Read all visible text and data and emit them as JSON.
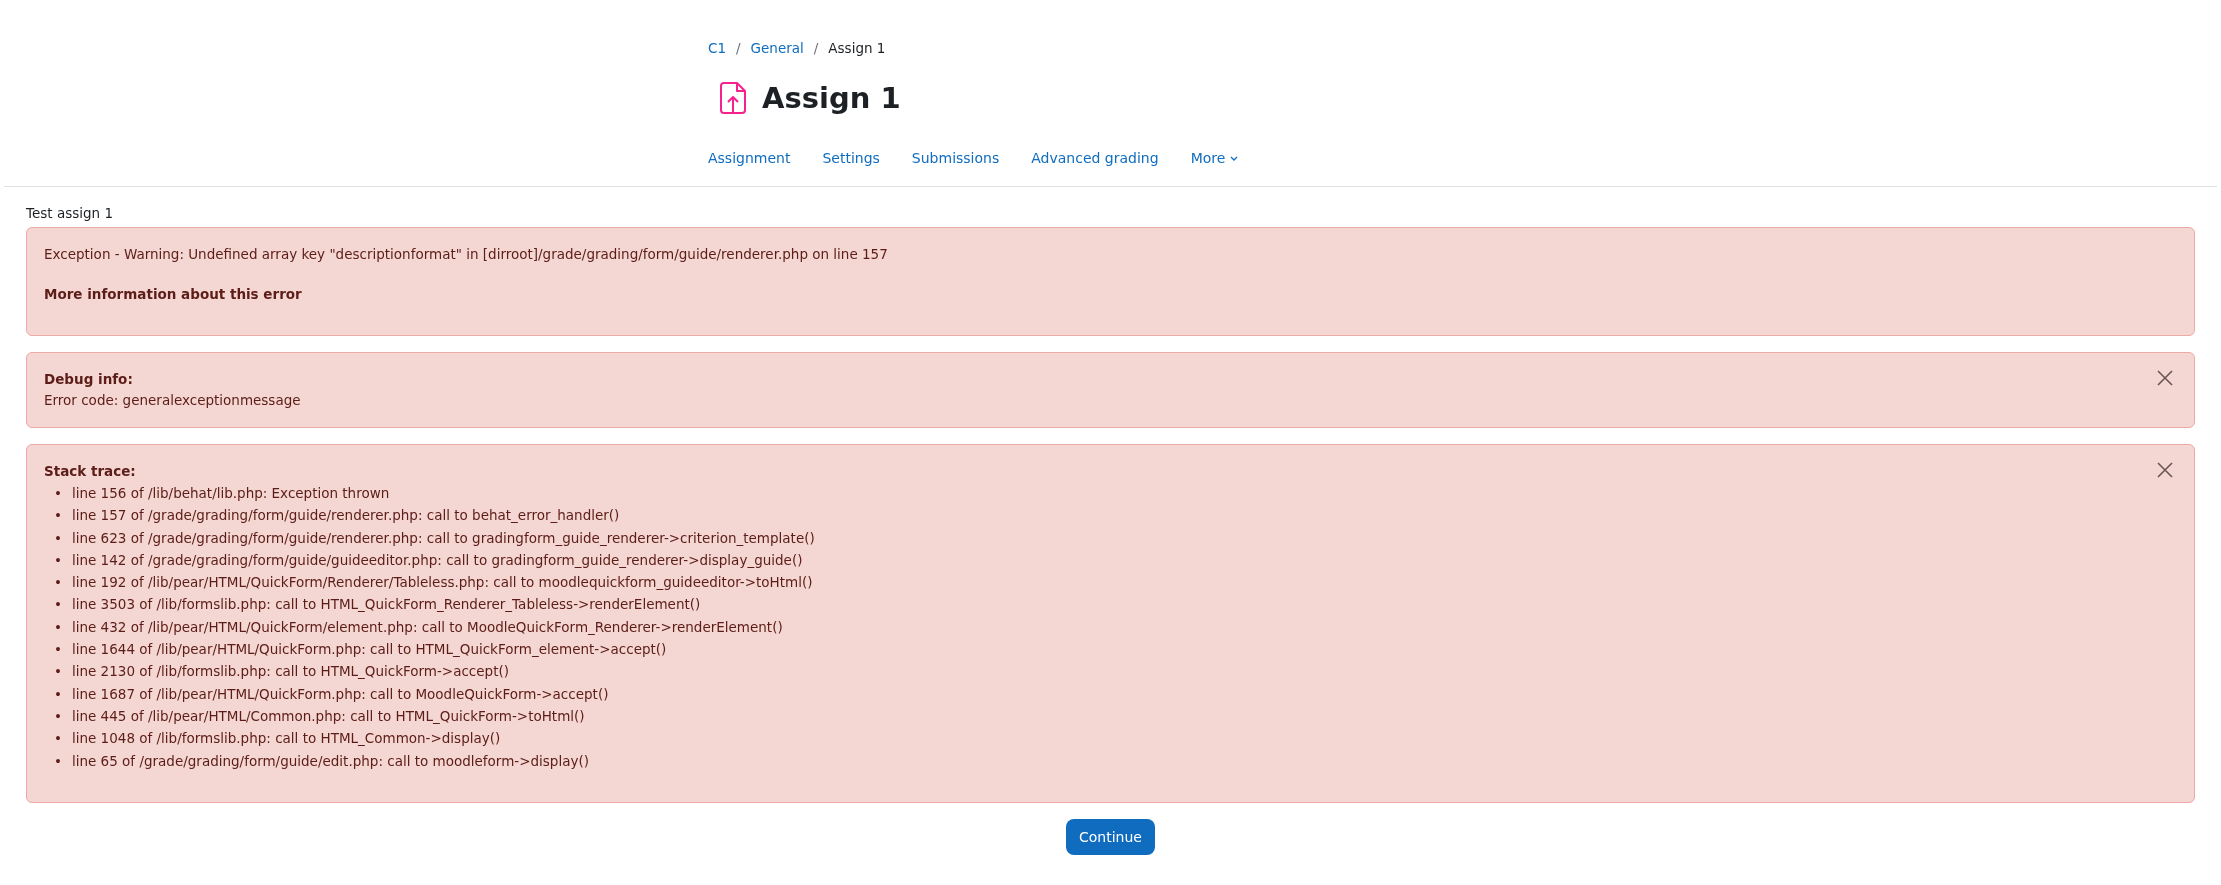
{
  "breadcrumb": [
    {
      "label": "C1",
      "link": true
    },
    {
      "label": "General",
      "link": true
    },
    {
      "label": "Assign 1",
      "link": false
    }
  ],
  "separator": "/",
  "page_title": "Assign 1",
  "nav_tabs": [
    {
      "label": "Assignment"
    },
    {
      "label": "Settings"
    },
    {
      "label": "Submissions"
    },
    {
      "label": "Advanced grading"
    },
    {
      "label": "More",
      "dropdown": true
    }
  ],
  "description": "Test assign 1",
  "error_alert": {
    "message": "Exception - Warning: Undefined array key \"descriptionformat\" in [dirroot]/grade/grading/form/guide/renderer.php on line 157",
    "more_info": "More information about this error"
  },
  "debug_alert": {
    "heading": "Debug info:",
    "text": "Error code: generalexceptionmessage",
    "dismissible": true
  },
  "stack_alert": {
    "heading": "Stack trace:",
    "dismissible": true,
    "bullet": "•",
    "lines": [
      "line 156 of /lib/behat/lib.php: Exception thrown",
      "line 157 of /grade/grading/form/guide/renderer.php: call to behat_error_handler()",
      "line 623 of /grade/grading/form/guide/renderer.php: call to gradingform_guide_renderer->criterion_template()",
      "line 142 of /grade/grading/form/guide/guideeditor.php: call to gradingform_guide_renderer->display_guide()",
      "line 192 of /lib/pear/HTML/QuickForm/Renderer/Tableless.php: call to moodlequickform_guideeditor->toHtml()",
      "line 3503 of /lib/formslib.php: call to HTML_QuickForm_Renderer_Tableless->renderElement()",
      "line 432 of /lib/pear/HTML/QuickForm/element.php: call to MoodleQuickForm_Renderer->renderElement()",
      "line 1644 of /lib/pear/HTML/QuickForm.php: call to HTML_QuickForm_element->accept()",
      "line 2130 of /lib/formslib.php: call to HTML_QuickForm->accept()",
      "line 1687 of /lib/pear/HTML/QuickForm.php: call to MoodleQuickForm->accept()",
      "line 445 of /lib/pear/HTML/Common.php: call to HTML_QuickForm->toHtml()",
      "line 1048 of /lib/formslib.php: call to HTML_Common->display()",
      "line 65 of /grade/grading/form/guide/edit.php: call to moodleform->display()"
    ]
  },
  "continue_button": "Continue"
}
